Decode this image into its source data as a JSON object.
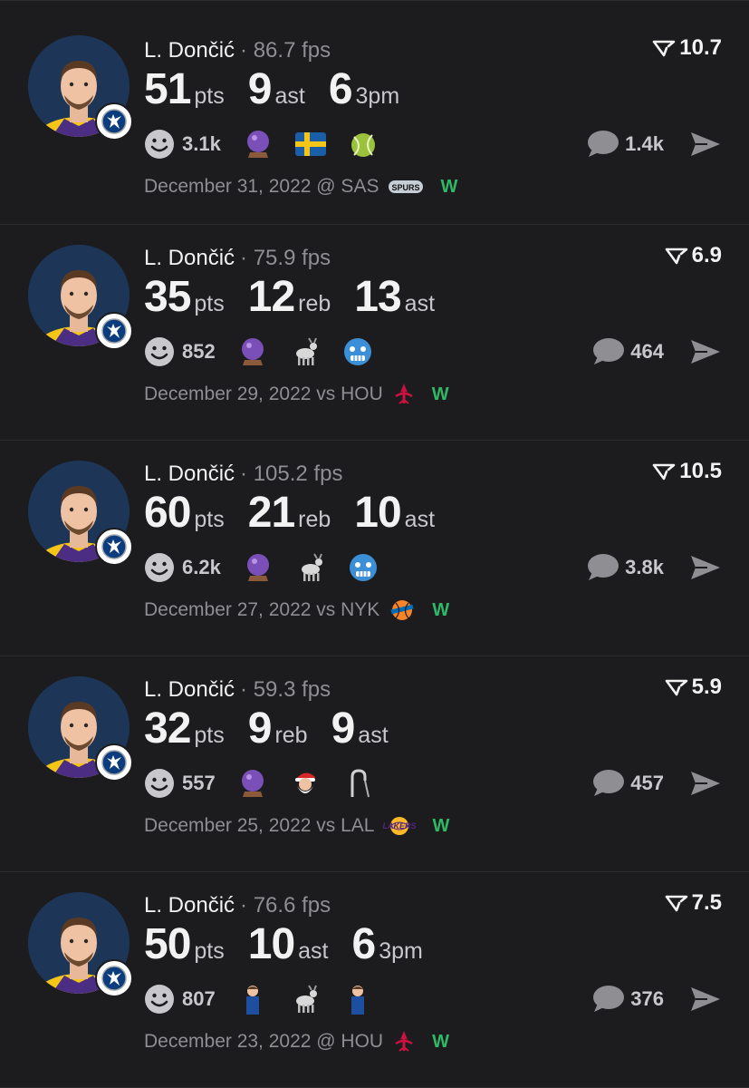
{
  "cards": [
    {
      "name": "L. Dončić",
      "fps": "· 86.7 fps",
      "score": "10.7",
      "stats": [
        {
          "num": "51",
          "lbl": "pts"
        },
        {
          "num": "9",
          "lbl": "ast"
        },
        {
          "num": "6",
          "lbl": "3pm"
        }
      ],
      "reactions": "3.1k",
      "emojis": [
        "crystal-ball",
        "sweden-flag",
        "tennis-ball"
      ],
      "comments": "1.4k",
      "date": "December 31, 2022 @ SAS",
      "opponent_logo": "spurs-logo",
      "result": "W"
    },
    {
      "name": "L. Dončić",
      "fps": "· 75.9 fps",
      "score": "6.9",
      "stats": [
        {
          "num": "35",
          "lbl": "pts"
        },
        {
          "num": "12",
          "lbl": "reb"
        },
        {
          "num": "13",
          "lbl": "ast"
        }
      ],
      "reactions": "852",
      "emojis": [
        "crystal-ball",
        "goat",
        "cold-face"
      ],
      "comments": "464",
      "date": "December 29, 2022 vs HOU",
      "opponent_logo": "rockets-logo",
      "result": "W"
    },
    {
      "name": "L. Dončić",
      "fps": "· 105.2 fps",
      "score": "10.5",
      "stats": [
        {
          "num": "60",
          "lbl": "pts"
        },
        {
          "num": "21",
          "lbl": "reb"
        },
        {
          "num": "10",
          "lbl": "ast"
        }
      ],
      "reactions": "6.2k",
      "emojis": [
        "crystal-ball",
        "goat",
        "cold-face"
      ],
      "comments": "3.8k",
      "date": "December 27, 2022 vs NYK",
      "opponent_logo": "knicks-logo",
      "result": "W"
    },
    {
      "name": "L. Dončić",
      "fps": "· 59.3 fps",
      "score": "5.9",
      "stats": [
        {
          "num": "32",
          "lbl": "pts"
        },
        {
          "num": "9",
          "lbl": "reb"
        },
        {
          "num": "9",
          "lbl": "ast"
        }
      ],
      "reactions": "557",
      "emojis": [
        "crystal-ball",
        "santa",
        "cane"
      ],
      "comments": "457",
      "date": "December 25, 2022 vs LAL",
      "opponent_logo": "lakers-logo",
      "result": "W"
    },
    {
      "name": "L. Dončić",
      "fps": "· 76.6 fps",
      "score": "7.5",
      "stats": [
        {
          "num": "50",
          "lbl": "pts"
        },
        {
          "num": "10",
          "lbl": "ast"
        },
        {
          "num": "6",
          "lbl": "3pm"
        }
      ],
      "reactions": "807",
      "emojis": [
        "player-sticker",
        "goat",
        "player-sticker"
      ],
      "comments": "376",
      "date": "December 23, 2022 @ HOU",
      "opponent_logo": "rockets-logo",
      "result": "W"
    }
  ],
  "colors": {
    "background": "#1c1c1e",
    "win": "#2fb866",
    "muted": "#8e8e93"
  }
}
